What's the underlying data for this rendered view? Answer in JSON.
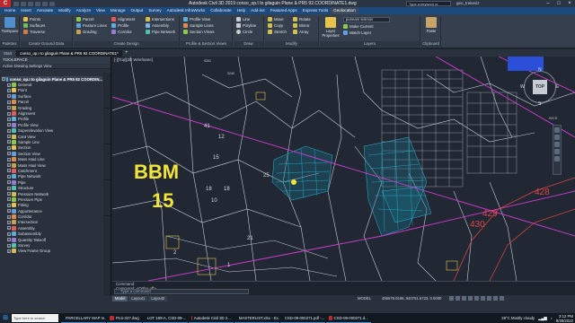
{
  "titlebar": {
    "app_icon": "C",
    "title": "Autodesk Civil 3D 2019    conso_op.I to gilaguin Plane & PR5 92.COORDINATE1.dwg",
    "search_placeholder": "Type a keyword or phrase",
    "user": "geo_trekeviz"
  },
  "menu_tabs": [
    "Home",
    "Insert",
    "Annotate",
    "Modify",
    "Analyze",
    "View",
    "Manage",
    "Output",
    "Survey",
    "Autodesk InfraWorks",
    "Collaborate",
    "Help",
    "Add-ins",
    "Featured Apps",
    "Express Tools",
    "Geolocation"
  ],
  "active_menu_tab": "Geolocation",
  "ribbon": {
    "palettes": {
      "label": "Palettes",
      "buttons": [
        "Toolspace"
      ]
    },
    "ground_data": {
      "label": "Create Ground Data",
      "rows": [
        "Points",
        "Surfaces",
        "Traverse"
      ]
    },
    "design": {
      "label": "Create Design",
      "rows": [
        "Parcel",
        "Feature Lines",
        "Grading",
        "Alignment",
        "Profile",
        "Corridor",
        "Intersections",
        "Assembly",
        "Pipe Network"
      ]
    },
    "profile_section": {
      "label": "Profile & Section Views",
      "rows": [
        "Profile View",
        "Sample Lines",
        "Section Views"
      ]
    },
    "draw": {
      "label": "Draw",
      "rows": [
        "Line",
        "Polyline",
        "Circle",
        "Arc"
      ]
    },
    "modify": {
      "label": "Modify",
      "rows": [
        "Move",
        "Copy",
        "Rotate",
        "Mirror",
        "Stretch",
        "Scale",
        "Trim",
        "Fillet",
        "Array"
      ]
    },
    "layers": {
      "label": "Layers",
      "current_layer": "puneam sisimov",
      "rows": [
        "Make Current",
        "Match Layer",
        "Layer Properties"
      ]
    },
    "clipboard": {
      "label": "Clipboard",
      "buttons": [
        "Paste"
      ]
    }
  },
  "doc_tabs": [
    "Start",
    "conso_op.I to gilaguin Plane & PR5 92 COORDINATE1*"
  ],
  "toolspace": {
    "title": "TOOLSPACE",
    "subheader": "Active Drawing Settings View",
    "tree_root": "conso_op.I to gilaguin Plane & PR5 92 COORDIN...",
    "items": [
      "General",
      "Point",
      "Surface",
      "Parcel",
      "Grading",
      "Alignment",
      "Profile",
      "Profile View",
      "Superelevation View",
      "Cant View",
      "Sample Line",
      "Section",
      "Section View",
      "Mass Haul Line",
      "Mass Haul View",
      "Catchment",
      "Pipe Network",
      "Pipe",
      "Structure",
      "Pressure Network",
      "Pressure Pipe",
      "Fitting",
      "Appurtenance",
      "Corridor",
      "Intersection",
      "Assembly",
      "Subassembly",
      "Quantity Takeoff",
      "Survey",
      "View Frame Group"
    ]
  },
  "viewport": {
    "label": "[-][Top][2D Wireframe]",
    "callout_title": "BBM",
    "callout_number": "15",
    "parcel_numbers": [
      "428",
      "429",
      "430",
      "5261",
      "5240",
      "41",
      "12",
      "15",
      "18",
      "10",
      "21",
      "25",
      "1",
      "2",
      "18"
    ],
    "navcube": {
      "face": "TOP",
      "n": "N",
      "s": "S",
      "e": "E",
      "w": "W"
    },
    "wcs": "WCS"
  },
  "command_line": {
    "history": [
      "Command:",
      "Command: <Ortho off>"
    ],
    "placeholder": "Type a command"
  },
  "statusbar": {
    "layout_tabs": [
      "Model",
      "Layout1",
      "Layout2"
    ],
    "active_layout": "Model",
    "model_label": "MODEL",
    "coords": "455578.0166, 940751.6723, 0.0000"
  },
  "taskbar": {
    "search_placeholder": "Type here to search",
    "items": [
      "PARCELLARY MAP re...",
      "PLS-327.dwg",
      "LOT 189-A, CSD-09-...",
      "Autodesk Civil 3D 2...",
      "MASTERLIST.xlsx - Ex...",
      "CSD-09-000271.pdf -...",
      "CSD-09-000271.d..."
    ],
    "weather": "28°C  Mostly cloudy",
    "time": "3:12 PM",
    "date": "8/28/2022"
  },
  "colors": {
    "accent_blue": "#1d4a7c",
    "magenta_line": "#d43bd4",
    "cyan_lots": "#28b7d8",
    "red_boundary": "#e34848",
    "yellow_text": "#f3e53a"
  }
}
